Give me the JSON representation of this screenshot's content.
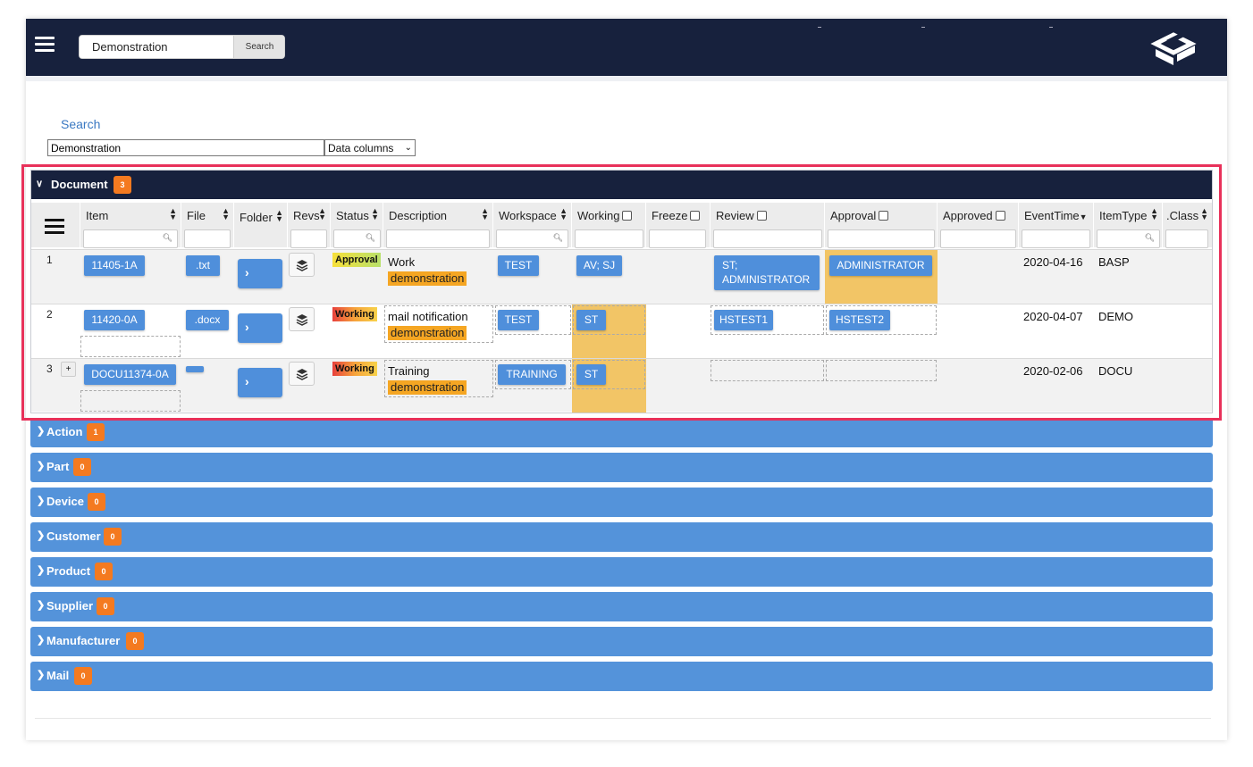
{
  "topbar": {
    "search_value": "Demonstration",
    "search_button": "Search",
    "menu_icon": "hamburger-icon",
    "logo_icon": "cube-logo-icon"
  },
  "search": {
    "link": "Search",
    "filter_value": "Demonstration",
    "columns_select": "Data columns"
  },
  "document": {
    "title": "Document",
    "count": "3",
    "columns": [
      "Item",
      "File",
      "Folder",
      "Revs",
      "Status",
      "Description",
      "Workspace",
      "Working",
      "Freeze",
      "Review",
      "Approval",
      "Approved",
      "EventTime",
      "ItemType",
      ".Class"
    ],
    "rows": [
      {
        "num": "1",
        "item": "11405-1A",
        "file": ".txt",
        "status": "Approval",
        "description": "Work",
        "tag": "demonstration",
        "workspace": "TEST",
        "working": "AV; SJ",
        "review_line1": "ST;",
        "review_line2": "ADMINISTRATOR",
        "approval": "ADMINISTRATOR",
        "event_time": "2020-04-16",
        "item_type": "BASP"
      },
      {
        "num": "2",
        "item": "11420-0A",
        "file": ".docx",
        "status": "Working",
        "description": "mail notification",
        "tag": "demonstration",
        "workspace": "TEST",
        "working": "ST",
        "review": "HSTEST1",
        "approval": "HSTEST2",
        "event_time": "2020-04-07",
        "item_type": "DEMO"
      },
      {
        "num": "3",
        "plus": "+",
        "item": "DOCU11374-0A",
        "file": "",
        "status": "Working",
        "description": "Training",
        "tag": "demonstration",
        "workspace": "TRAINING",
        "working": "ST",
        "event_time": "2020-02-06",
        "item_type": "DOCU"
      }
    ]
  },
  "sections": [
    {
      "title": "Action",
      "count": "1"
    },
    {
      "title": "Part",
      "count": "0"
    },
    {
      "title": "Device",
      "count": "0"
    },
    {
      "title": "Customer",
      "count": "0"
    },
    {
      "title": "Product",
      "count": "0"
    },
    {
      "title": "Supplier",
      "count": "0"
    },
    {
      "title": "Manufacturer",
      "count": "0"
    },
    {
      "title": "Mail",
      "count": "0"
    }
  ],
  "colors": {
    "topbar": "#17213d",
    "button_blue": "#4f8fdb",
    "section_blue": "#5493da",
    "badge_orange": "#f47a20",
    "tag_orange": "#f5a623",
    "highlight_yellow": "#f2c566",
    "annotation_red": "#e8315a"
  }
}
